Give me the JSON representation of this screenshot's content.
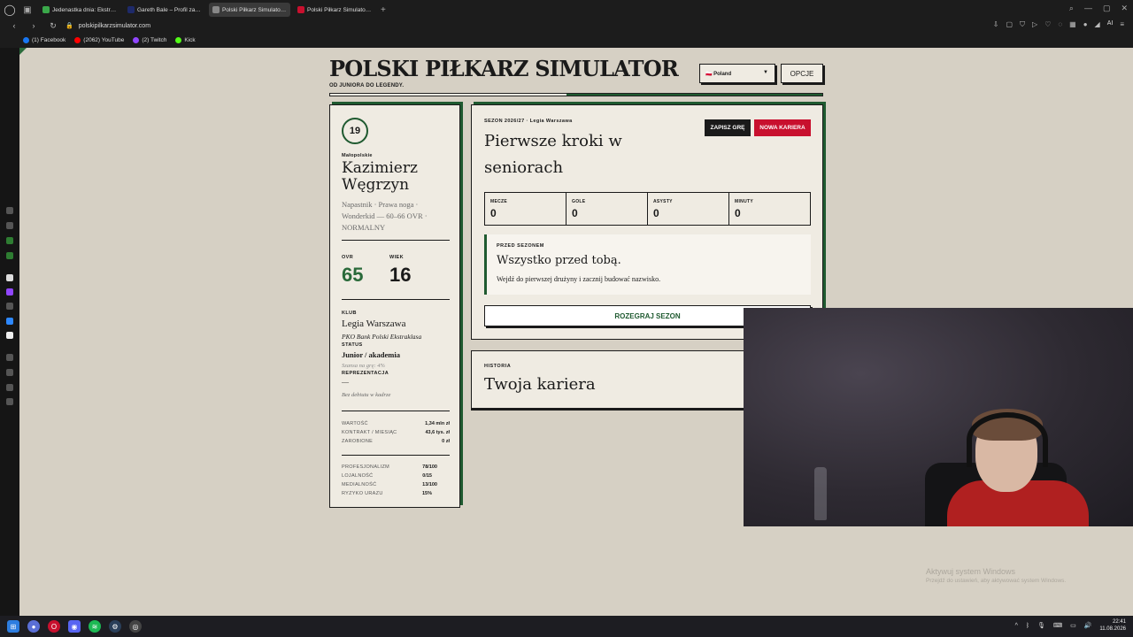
{
  "browser": {
    "tabs": [
      {
        "title": "Jedenastka dnia: Ekstraklasa",
        "favicon_color": "#3aa84a",
        "active": false
      },
      {
        "title": "Gareth Bale – Profil zawodnika",
        "favicon_color": "#1e2a6a",
        "active": false
      },
      {
        "title": "Polski Piłkarz Simulator — Od juniora do legendy",
        "favicon_color": "#888888",
        "active": true
      },
      {
        "title": "Polski Piłkarz Simulator — Od juniora do legendy",
        "favicon_color": "#c8102e",
        "active": false
      }
    ],
    "url": "polskipilkarzsimulator.com",
    "ai_label": "AI",
    "bookmarks": [
      {
        "label": "(1) Facebook",
        "color": "#1877f2"
      },
      {
        "label": "(2062) YouTube",
        "color": "#ff0000"
      },
      {
        "label": "(2) Twitch",
        "color": "#9146ff"
      },
      {
        "label": "Kick",
        "color": "#53fc18"
      }
    ]
  },
  "site": {
    "title": "POLSKI PIŁKARZ SIMULATOR",
    "tagline": "OD JUNIORA DO LEGENDY.",
    "progress_fraction": 0.48,
    "country_value": "🇵🇱 Poland",
    "options_label": "OPCJE"
  },
  "player": {
    "age_badge": "19",
    "region": "Małopolskie",
    "name": "Kazimierz Węgrzyn",
    "description": "Napastnik · Prawa noga · Wonderkid — 60–66 OVR · NORMALNY",
    "ovr_label": "OVR",
    "ovr_value": "65",
    "age_label": "WIEK",
    "age_value": "16",
    "club_label": "KLUB",
    "club_name": "Legia Warszawa",
    "league": "PKO Bank Polski Ekstraklasa",
    "status_label": "STATUS",
    "status_value": "Junior / akademia",
    "play_chance": "Szansa na grę: 4%",
    "national_label": "REPREZENTACJA",
    "national_value": "—",
    "national_note": "Bez debiutu w kadrze",
    "finance": [
      {
        "key": "WARTOŚĆ",
        "value": "1,34 mln zł"
      },
      {
        "key": "KONTRAKT / MIESIĄC",
        "value": "43,6 tys. zł"
      },
      {
        "key": "ZAROBIONE",
        "value": "0 zł"
      }
    ],
    "attributes": [
      {
        "key": "PROFESJONALIZM",
        "value": "78/100"
      },
      {
        "key": "LOJALNOŚĆ",
        "value": "0/15"
      },
      {
        "key": "MEDIALNOŚĆ",
        "value": "13/100"
      },
      {
        "key": "RYZYKO URAZU",
        "value": "15%"
      }
    ]
  },
  "season": {
    "label": "SEZON 2026/27 · Legia Warszawa",
    "title": "Pierwsze kroki w seniorach",
    "save_label": "ZAPISZ GRĘ",
    "new_career_label": "NOWA KARIERA",
    "stats": [
      {
        "label": "MECZE",
        "value": "0"
      },
      {
        "label": "GOLE",
        "value": "0"
      },
      {
        "label": "ASYSTY",
        "value": "0"
      },
      {
        "label": "MINUTY",
        "value": "0"
      }
    ],
    "preseason_label": "PRZED SEZONEM",
    "preseason_title": "Wszystko przed tobą.",
    "preseason_desc": "Wejdź do pierwszej drużyny i zacznij budować nazwisko.",
    "play_label": "ROZEGRAJ SEZON"
  },
  "history": {
    "label": "HISTORIA",
    "title": "Twoja kariera"
  },
  "windows": {
    "activate_title": "Aktywuj system Windows",
    "activate_sub": "Przejdź do ustawień, aby aktywować system Windows.",
    "time": "22:41",
    "date": "11.08.2026"
  },
  "colors": {
    "accent_green": "#1f5a30",
    "ovr_green": "#2a6a3a",
    "danger_red": "#c8102e",
    "page_bg": "#d6d0c4",
    "card_bg": "#efebe2"
  }
}
